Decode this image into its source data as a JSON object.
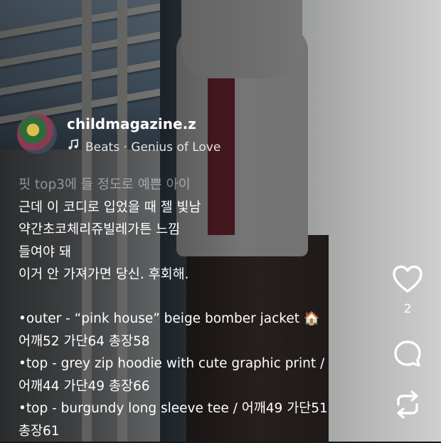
{
  "post": {
    "username": "childmagazine.z",
    "music": {
      "artist": "Beats",
      "separator": "·",
      "title": "Genius of Love"
    },
    "caption_lines": [
      "핏 top3에 들 정도로 예쁜 아이",
      "근데 이 코디로 입었을 때 젤 빛남",
      "약간초코체리쥬빌레가튼 느낌",
      "들여야 돼",
      "이거 안 가져가면 당신. 후회해."
    ],
    "item_lines": [
      "•outer - “pink house” beige bomber jacket 🏠",
      "어깨52 가단64 총장58",
      "•top - grey zip hoodie with cute graphic print /",
      "어깨44 가단49 총장66",
      "•top - burgundy long sleeve tee / 어깨49 가단51",
      "총장61"
    ]
  },
  "actions": {
    "like_icon": "heart-icon",
    "like_count": "2",
    "comment_icon": "comment-bubble-icon",
    "repost_icon": "repost-icon"
  }
}
